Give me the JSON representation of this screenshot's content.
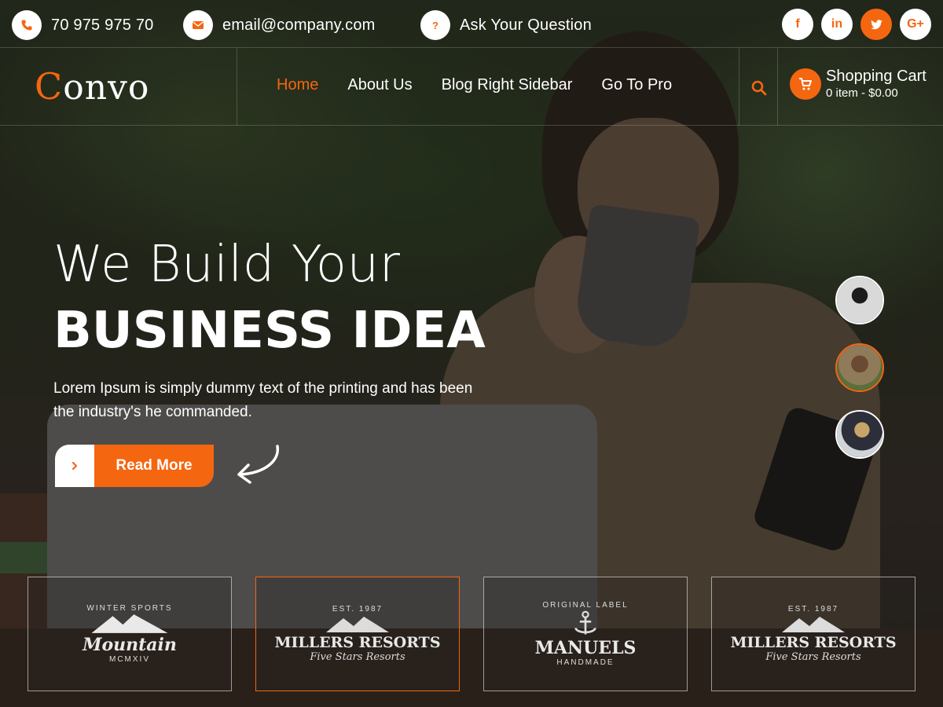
{
  "topbar": {
    "phone": "70 975 975 70",
    "email": "email@company.com",
    "question": "Ask Your Question",
    "socials": [
      {
        "icon": "facebook-icon",
        "glyph": "f"
      },
      {
        "icon": "linkedin-icon",
        "glyph": "in"
      },
      {
        "icon": "twitter-icon",
        "glyph": "t"
      },
      {
        "icon": "google-plus-icon",
        "glyph": "G+"
      }
    ]
  },
  "header": {
    "logo_first": "C",
    "logo_rest": "onvo",
    "menu": [
      "Home",
      "About Us",
      "Blog Right Sidebar",
      "Go To Pro"
    ],
    "cart_title": "Shopping Cart",
    "cart_summary": "0 item - $0.00"
  },
  "hero": {
    "line1": "We Build Your",
    "line2": "BUSINESS IDEA",
    "paragraph": "Lorem Ipsum is simply dummy text of the printing and has been the industry's he commanded.",
    "button_label": "Read More"
  },
  "clients": [
    {
      "top": "WINTER SPORTS",
      "name": "Mountain",
      "bottom": "MCMXIV"
    },
    {
      "top": "EST. 1987",
      "name": "MILLERS RESORTS",
      "bottom": "Five Stars Resorts"
    },
    {
      "top": "ORIGINAL LABEL",
      "name": "MANUELS",
      "bottom": "HANDMADE"
    },
    {
      "top": "EST. 1987",
      "name": "MILLERS RESORTS",
      "bottom": "Five Stars Resorts"
    }
  ],
  "colors": {
    "accent": "#f46610",
    "text": "#ffffff"
  }
}
